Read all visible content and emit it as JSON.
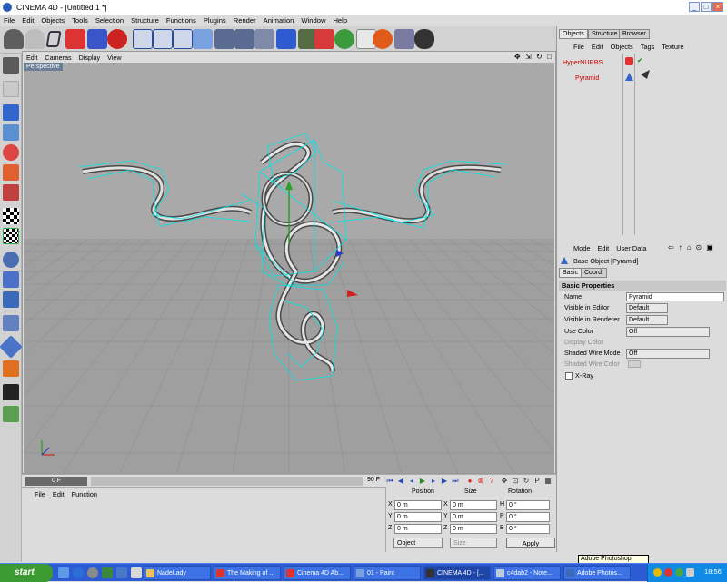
{
  "window": {
    "title": "CINEMA 4D - [Untitled 1 *]"
  },
  "menu": [
    "File",
    "Edit",
    "Objects",
    "Tools",
    "Selection",
    "Structure",
    "Functions",
    "Plugins",
    "Render",
    "Animation",
    "Window",
    "Help"
  ],
  "viewport": {
    "menu": [
      "Edit",
      "Cameras",
      "Display",
      "View"
    ],
    "label": "Perspective"
  },
  "timeline": {
    "current_frame": "0 F",
    "end_frame": "90 F"
  },
  "material_manager": {
    "menu": [
      "File",
      "Edit",
      "Function"
    ]
  },
  "coordinates": {
    "headers": [
      "Position",
      "Size",
      "Rotation"
    ],
    "rows": [
      {
        "axis": "X",
        "pos": "0 m",
        "size_axis": "X",
        "size": "0 m",
        "rot_axis": "H",
        "rot": "0 °"
      },
      {
        "axis": "Y",
        "pos": "0 m",
        "size_axis": "Y",
        "size": "0 m",
        "rot_axis": "P",
        "rot": "0 °"
      },
      {
        "axis": "Z",
        "pos": "0 m",
        "size_axis": "Z",
        "size": "0 m",
        "rot_axis": "B",
        "rot": "0 °"
      }
    ],
    "mode": "Object",
    "size_mode": "Size",
    "apply_label": "Apply"
  },
  "objects_panel": {
    "tabs": [
      "Objects",
      "Structure",
      "Browser"
    ],
    "menu": [
      "File",
      "Edit",
      "Objects",
      "Tags",
      "Texture"
    ],
    "items": [
      "HyperNURBS",
      "Pyramid"
    ]
  },
  "attributes": {
    "menu": [
      "Mode",
      "Edit",
      "User Data"
    ],
    "object_title": "Base Object [Pyramid]",
    "tabs": [
      "Basic",
      "Coord."
    ],
    "section": "Basic Properties",
    "name_label": "Name",
    "name_value": "Pyramid",
    "vis_editor_label": "Visible in Editor",
    "vis_editor_value": "Default",
    "vis_render_label": "Visible in Renderer",
    "vis_render_value": "Default",
    "use_color_label": "Use Color",
    "use_color_value": "Off",
    "display_color_label": "Display Color",
    "shaded_wire_mode_label": "Shaded Wire Mode",
    "shaded_wire_mode_value": "Off",
    "shaded_wire_color_label": "Shaded Wire Color",
    "xray_label": "X-Ray"
  },
  "taskbar": {
    "start_label": "start",
    "tasks": [
      "NadeLady",
      "The Making of ...",
      "Cinema 4D Ab...",
      "01 - Paint",
      "CINEMA 4D - [...",
      "c4dab2 - Note...",
      "Adobe Photos..."
    ],
    "clock": "18:56",
    "tooltip": "Adobe Photoshop"
  },
  "colors": {
    "accent": "#2c5bd4",
    "selection_wire": "#00e5e5",
    "object_red": "#cc0000"
  }
}
